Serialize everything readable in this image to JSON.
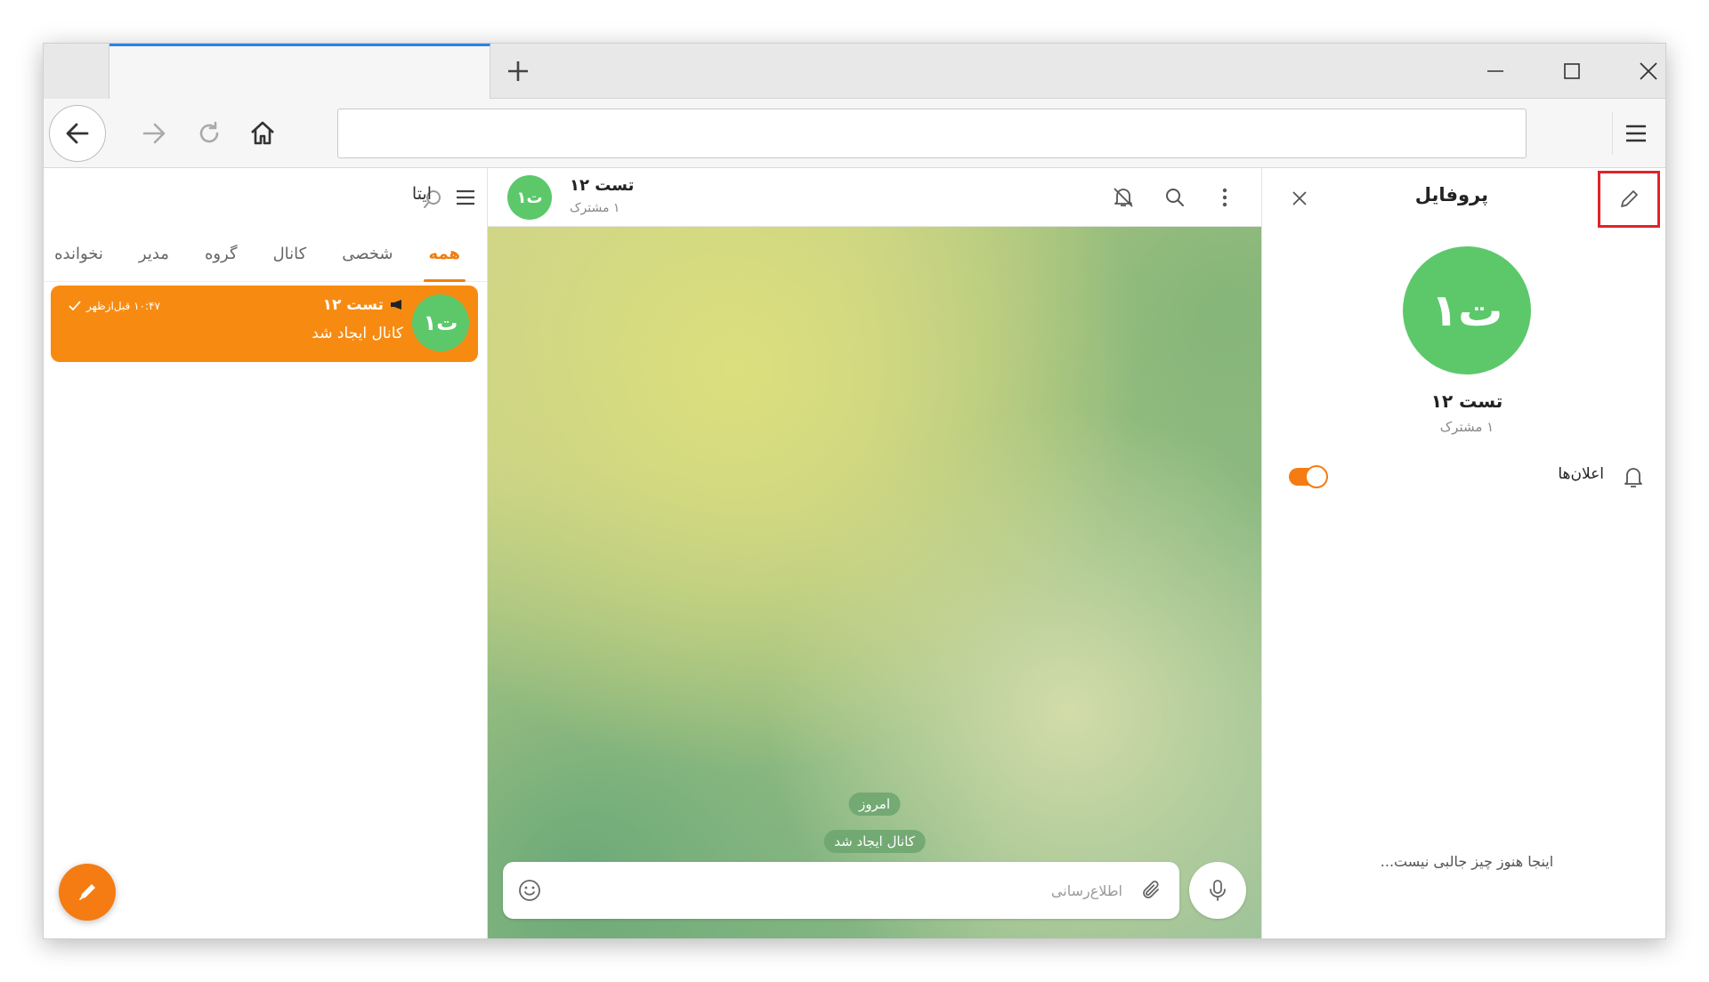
{
  "colors": {
    "accent": "#f47c12",
    "active_chat_bg": "#f78b12",
    "avatar_green": "#5cc86a",
    "tab_indicator_blue": "#2a83e8",
    "highlight_red": "#e0232a"
  },
  "browser": {
    "tab_new_icon": "plus-icon",
    "window_controls": [
      "minimize-icon",
      "maximize-icon",
      "close-icon"
    ],
    "nav_icons": [
      "back-arrow-icon",
      "forward-arrow-icon",
      "reload-icon",
      "home-icon"
    ],
    "menu_icon": "hamburger-menu-icon",
    "url": ""
  },
  "sidebar": {
    "app_name": "ایتا",
    "folders": [
      "همه",
      "شخصی",
      "کانال",
      "گروه",
      "مدیر",
      "نخوانده"
    ],
    "active_folder_index": 0,
    "chats": [
      {
        "avatar_text": "ت۱",
        "title": "تست ۱۲",
        "subtitle": "کانال ایجاد شد",
        "time": "۱۰:۴۷ قبل‌ازظهر"
      }
    ]
  },
  "chat": {
    "avatar_text": "ت۱",
    "title": "تست ۱۲",
    "subtitle": "۱ مشترک",
    "date_pill": "امروز",
    "service_message": "کانال ایجاد شد",
    "composer_placeholder": "اطلاع‌رسانی"
  },
  "profile": {
    "title": "پروفایل",
    "avatar_text": "ت۱",
    "name": "تست ۱۲",
    "subtitle": "۱ مشترک",
    "notifications_label": "اعلان‌ها",
    "notifications_on": true,
    "empty_text": "اینجا هنوز چیز جالبی نیست..."
  }
}
